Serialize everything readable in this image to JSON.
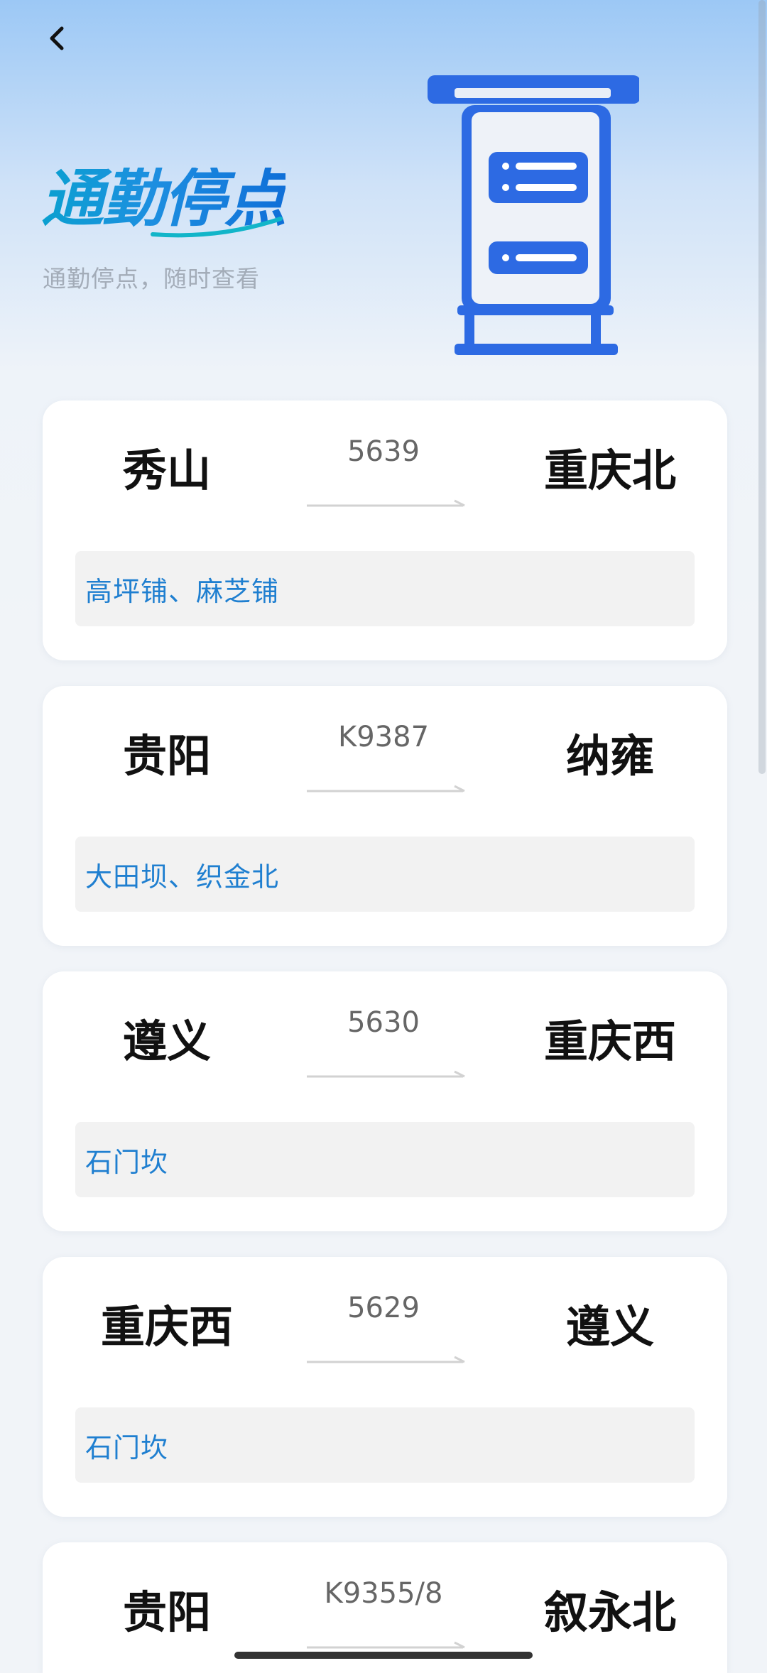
{
  "header": {
    "title": "通勤停点",
    "subtitle": "通勤停点，随时查看"
  },
  "icons": {
    "back": "chevron-left-icon",
    "illustration": "kiosk-sign-icon",
    "arrow": "arrow-right-icon"
  },
  "colors": {
    "title_gradient_start": "#0aa0d0",
    "title_gradient_end": "#0f6fd8",
    "stops_text": "#1f7fd0",
    "kiosk_blue": "#2d6ae3"
  },
  "trains": [
    {
      "from": "秀山",
      "to": "重庆北",
      "train_no": "5639",
      "stops": "高坪铺、麻芝铺"
    },
    {
      "from": "贵阳",
      "to": "纳雍",
      "train_no": "K9387",
      "stops": "大田坝、织金北"
    },
    {
      "from": "遵义",
      "to": "重庆西",
      "train_no": "5630",
      "stops": "石门坎"
    },
    {
      "from": "重庆西",
      "to": "遵义",
      "train_no": "5629",
      "stops": "石门坎"
    },
    {
      "from": "贵阳",
      "to": "叙永北",
      "train_no": "K9355/8",
      "stops": ""
    }
  ]
}
